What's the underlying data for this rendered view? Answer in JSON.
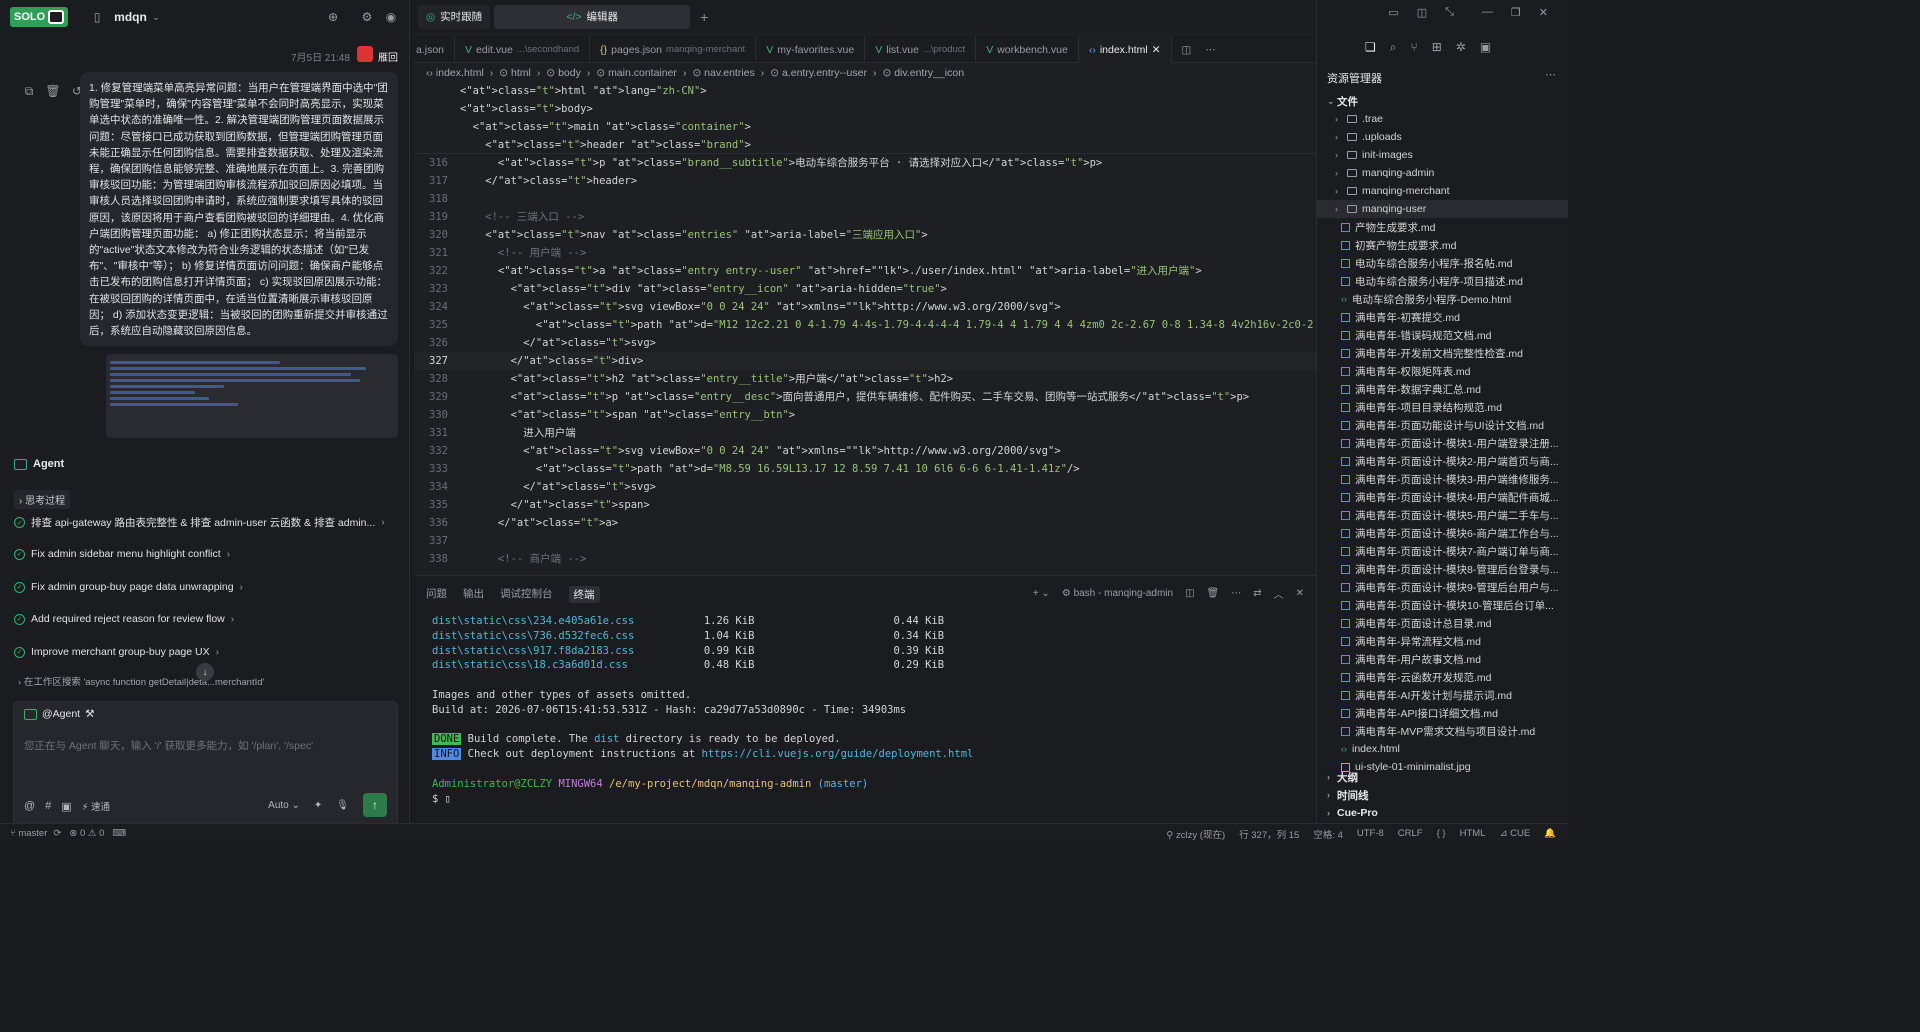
{
  "chat": {
    "logo": "SOLO",
    "project": "mdqn",
    "timestamp": "7月5日 21:48",
    "username": "雁回",
    "message": "1. 修复管理端菜单高亮异常问题：当用户在管理端界面中选中\"团购管理\"菜单时，确保\"内容管理\"菜单不会同时高亮显示，实现菜单选中状态的准确唯一性。2. 解决管理端团购管理页面数据展示问题：尽管接口已成功获取到团购数据，但管理端团购管理页面未能正确显示任何团购信息。需要排查数据获取、处理及渲染流程，确保团购信息能够完整、准确地展示在页面上。3. 完善团购审核驳回功能：为管理端团购审核流程添加驳回原因必填项。当审核人员选择驳回团购申请时，系统应强制要求填写具体的驳回原因，该原因将用于商户查看团购被驳回的详细理由。4. 优化商户端团购管理页面功能：    a) 修正团购状态显示：将当前显示的\"active\"状态文本修改为符合业务逻辑的状态描述（如\"已发布\"、\"审核中\"等）；   b) 修复详情页面访问问题：确保商户能够点击已发布的团购信息打开详情页面；    c) 实现驳回原因展示功能：在被驳回团购的详情页面中，在适当位置清晰展示审核驳回原因；    d) 添加状态变更逻辑：当被驳回的团购重新提交并审核通过后，系统应自动隐藏驳回原因信息。",
    "agent_label": "Agent",
    "think_label": "思考过程",
    "tasks": [
      "排查 api-gateway 路由表完整性 & 排查 admin-user 云函数 & 排查 admin...",
      "Fix admin sidebar menu highlight conflict",
      "Fix admin group-buy page data unwrapping",
      "Add required reject reason for review flow",
      "Improve merchant group-buy page UX"
    ],
    "search_note": "在工作区搜索 'async function getDetail|deta...merchantId'",
    "input_tag": "@Agent",
    "input_placeholder": "您正在与 Agent 聊天，输入 '/' 获取更多能力，如 '/plan', '/spec'",
    "tool_speed": "速通",
    "mode": "Auto"
  },
  "editor": {
    "top_tabs": [
      "实时跟随",
      "编辑器"
    ],
    "file_tabs": [
      {
        "name": "a.json",
        "sub": ""
      },
      {
        "name": "edit.vue",
        "sub": "...\\secondhand"
      },
      {
        "name": "pages.json",
        "sub": "manqing-merchant"
      },
      {
        "name": "my-favorites.vue",
        "sub": ""
      },
      {
        "name": "list.vue",
        "sub": "...\\product"
      },
      {
        "name": "workbench.vue",
        "sub": ""
      },
      {
        "name": "index.html",
        "sub": ""
      }
    ],
    "breadcrumb": [
      "index.html",
      "html",
      "body",
      "main.container",
      "nav.entries",
      "a.entry.entry--user",
      "div.entry__icon"
    ],
    "sticky_lines": [
      "<html lang=\"zh-CN\">",
      "<body>",
      "  <main class=\"container\">",
      "    <header class=\"brand\">"
    ],
    "line_numbers": [
      "316",
      "317",
      "318",
      "319",
      "320",
      "321",
      "322",
      "323",
      "324",
      "325",
      "326",
      "327",
      "328",
      "329",
      "330",
      "331",
      "332",
      "333",
      "334",
      "335",
      "336",
      "337",
      "338"
    ],
    "current_line": "327",
    "lines": [
      "      <p class=\"brand__subtitle\">电动车综合服务平台 · 请选择对应入口</p>",
      "    </header>",
      "",
      "    <!-- 三端入口 -->",
      "    <nav class=\"entries\" aria-label=\"三端应用入口\">",
      "      <!-- 用户端 -->",
      "      <a class=\"entry entry--user\" href=\"./user/index.html\" aria-label=\"进入用户端\">",
      "        <div class=\"entry__icon\" aria-hidden=\"true\">",
      "          <svg viewBox=\"0 0 24 24\" xmlns=\"http://www.w3.org/2000/svg\">",
      "            <path d=\"M12 12c2.21 0 4-1.79 4-4s-1.79-4-4-4-4 1.79-4 4 1.79 4 4 4zm0 2c-2.67 0-8 1.34-8 4v2h16v-2c0-2.66-5.33-4-8-4z\"/>",
      "          </svg>",
      "        </div>",
      "        <h2 class=\"entry__title\">用户端</h2>",
      "        <p class=\"entry__desc\">面向普通用户，提供车辆维修、配件购买、二手车交易、团购等一站式服务</p>",
      "        <span class=\"entry__btn\">",
      "          进入用户端",
      "          <svg viewBox=\"0 0 24 24\" xmlns=\"http://www.w3.org/2000/svg\">",
      "            <path d=\"M8.59 16.59L13.17 12 8.59 7.41 10 6l6 6-6 6-1.41-1.41z\"/>",
      "          </svg>",
      "        </span>",
      "      </a>",
      "",
      "      <!-- 商户端 -->"
    ]
  },
  "terminal": {
    "tabs": [
      "问题",
      "输出",
      "调试控制台",
      "终端"
    ],
    "active_tab": "终端",
    "shell": "bash - manqing-admin",
    "assets": [
      {
        "file": "dist\\static\\css\\234.e405a61e.css",
        "size": "1.26 KiB",
        "gzip": "0.44 KiB"
      },
      {
        "file": "dist\\static\\css\\736.d532fec6.css",
        "size": "1.04 KiB",
        "gzip": "0.34 KiB"
      },
      {
        "file": "dist\\static\\css\\917.f8da2183.css",
        "size": "0.99 KiB",
        "gzip": "0.39 KiB"
      },
      {
        "file": "dist\\static\\css\\18.c3a6d01d.css",
        "size": "0.48 KiB",
        "gzip": "0.29 KiB"
      }
    ],
    "omitted": "Images and other types of assets omitted.",
    "build_at": "Build at: 2026-07-06T15:41:53.531Z - Hash: ca29d77a53d0890c - Time: 34903ms",
    "done_badge": "DONE",
    "done_text_1": "Build complete. The ",
    "done_dist": "dist",
    "done_text_2": " directory is ready to be deployed.",
    "info_badge": "INFO",
    "info_text": "Check out deployment instructions at ",
    "info_link": "https://cli.vuejs.org/guide/deployment.html",
    "prompt_user": "Administrator@ZCLZY",
    "prompt_env": "MINGW64",
    "prompt_path": "/e/my-project/mdqn/manqing-admin",
    "prompt_branch": "(master)",
    "prompt_char": "$"
  },
  "status": {
    "branch": "master",
    "errors": "0",
    "warnings": "0",
    "user": "zclzy (现在)",
    "position": "行 327，列 15",
    "spaces": "空格: 4",
    "encoding": "UTF-8",
    "eol": "CRLF",
    "braces": "{ }",
    "lang": "HTML",
    "cue": "CUE"
  },
  "explorer": {
    "title": "资源管理器",
    "files_section": "文件",
    "folders": [
      ".trae",
      ".uploads",
      "init-images",
      "manqing-admin",
      "manqing-merchant",
      "manqing-user"
    ],
    "files": [
      {
        "name": "产物生成要求.md",
        "type": "md"
      },
      {
        "name": "初赛产物生成要求.md",
        "type": "md"
      },
      {
        "name": "电动车综合服务小程序-报名帖.md",
        "type": "md"
      },
      {
        "name": "电动车综合服务小程序-项目描述.md",
        "type": "md"
      },
      {
        "name": "电动车综合服务小程序-Demo.html",
        "type": "html"
      },
      {
        "name": "满电青年-初赛提交.md",
        "type": "md"
      },
      {
        "name": "满电青年-错误码规范文档.md",
        "type": "md"
      },
      {
        "name": "满电青年-开发前文档完整性检查.md",
        "type": "md"
      },
      {
        "name": "满电青年-权限矩阵表.md",
        "type": "md"
      },
      {
        "name": "满电青年-数据字典汇总.md",
        "type": "md"
      },
      {
        "name": "满电青年-项目目录结构规范.md",
        "type": "md"
      },
      {
        "name": "满电青年-页面功能设计与UI设计文档.md",
        "type": "md"
      },
      {
        "name": "满电青年-页面设计-模块1-用户端登录注册...",
        "type": "md"
      },
      {
        "name": "满电青年-页面设计-模块2-用户端首页与商...",
        "type": "md"
      },
      {
        "name": "满电青年-页面设计-模块3-用户端维修服务...",
        "type": "md"
      },
      {
        "name": "满电青年-页面设计-模块4-用户端配件商城...",
        "type": "md"
      },
      {
        "name": "满电青年-页面设计-模块5-用户端二手车与...",
        "type": "md"
      },
      {
        "name": "满电青年-页面设计-模块6-商户端工作台与...",
        "type": "md"
      },
      {
        "name": "满电青年-页面设计-模块7-商户端订单与商...",
        "type": "md"
      },
      {
        "name": "满电青年-页面设计-模块8-管理后台登录与...",
        "type": "md"
      },
      {
        "name": "满电青年-页面设计-模块9-管理后台用户与...",
        "type": "md"
      },
      {
        "name": "满电青年-页面设计-模块10-管理后台订单...",
        "type": "md"
      },
      {
        "name": "满电青年-页面设计总目录.md",
        "type": "md"
      },
      {
        "name": "满电青年-异常流程文档.md",
        "type": "md"
      },
      {
        "name": "满电青年-用户故事文档.md",
        "type": "md"
      },
      {
        "name": "满电青年-云函数开发规范.md",
        "type": "md"
      },
      {
        "name": "满电青年-AI开发计划与提示词.md",
        "type": "md"
      },
      {
        "name": "满电青年-API接口详细文档.md",
        "type": "md"
      },
      {
        "name": "满电青年-MVP需求文档与项目设计.md",
        "type": "md"
      },
      {
        "name": "index.html",
        "type": "html"
      },
      {
        "name": "ui-style-01-minimalist.jpg",
        "type": "img"
      }
    ],
    "bottom_sections": [
      "大纲",
      "时间线",
      "Cue-Pro"
    ]
  }
}
